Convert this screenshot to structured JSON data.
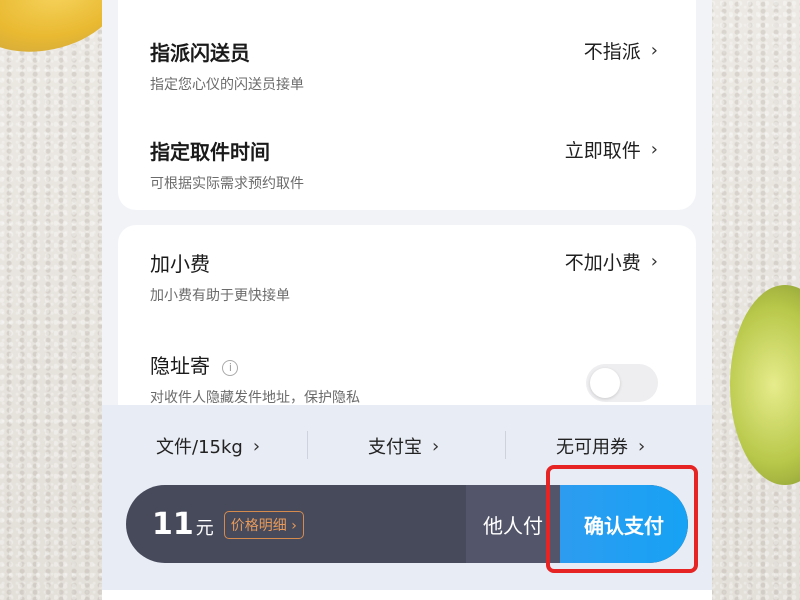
{
  "dispatch": {
    "title": "指派闪送员",
    "subtitle": "指定您心仪的闪送员接单",
    "value": "不指派"
  },
  "pickup_time": {
    "title": "指定取件时间",
    "subtitle": "可根据实际需求预约取件",
    "value": "立即取件"
  },
  "tip": {
    "title": "加小费",
    "subtitle": "加小费有助于更快接单",
    "value": "不加小费"
  },
  "hidden_address": {
    "title": "隐址寄",
    "subtitle": "对收件人隐藏发件地址，保护隐私",
    "enabled": false
  },
  "options": {
    "package": "文件/15kg",
    "payment_method": "支付宝",
    "coupon": "无可用券"
  },
  "payment": {
    "amount": "11",
    "unit": "元",
    "detail_label": "价格明细",
    "others_pay_label": "他人付",
    "confirm_label": "确认支付"
  },
  "colors": {
    "confirm": "#16a2f5",
    "pay_bar": "#474a5b",
    "highlight": "#e62424",
    "detail_accent": "#e79a5a"
  }
}
